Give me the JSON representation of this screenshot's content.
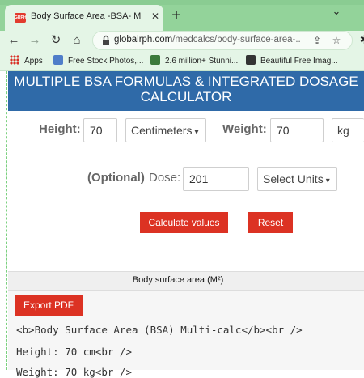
{
  "browser": {
    "tab_title": "Body Surface Area -BSA- Multi-calc",
    "favicon_text": "GRPH",
    "url_host": "globalrph.com",
    "url_path": "/medcalcs/body-surface-area-...",
    "bookmarks": [
      {
        "label": "Apps",
        "color": "#d93025"
      },
      {
        "label": "Free Stock Photos,...",
        "color": "#4f7dc9"
      },
      {
        "label": "2.6 million+ Stunni...",
        "color": "#3c7a3c"
      },
      {
        "label": "Beautiful Free Imag...",
        "color": "#333333"
      }
    ]
  },
  "banner": {
    "line1": "MULTIPLE BSA FORMULAS & INTEGRATED DOSAGE",
    "line2": "CALCULATOR"
  },
  "form": {
    "height_label": "Height:",
    "height_value": "70",
    "height_unit": "Centimeters",
    "weight_label": "Weight:",
    "weight_value": "70",
    "weight_unit": "kg",
    "optional_label": "(Optional)",
    "dose_label": "Dose:",
    "dose_value": "201",
    "dose_unit": "Select Units"
  },
  "buttons": {
    "calculate": "Calculate values",
    "reset": "Reset",
    "export_pdf": "Export PDF"
  },
  "result": {
    "section_title": "Body surface area (M²)",
    "lines": [
      "<b>Body Surface Area (BSA) Multi-calc</b><br />",
      "Height:  70 cm<br />",
      "Weight:  70 kg<br />"
    ]
  },
  "colors": {
    "tabstrip": "#93d39a",
    "banner": "#2f6aa8",
    "red_button": "#dc3223"
  }
}
